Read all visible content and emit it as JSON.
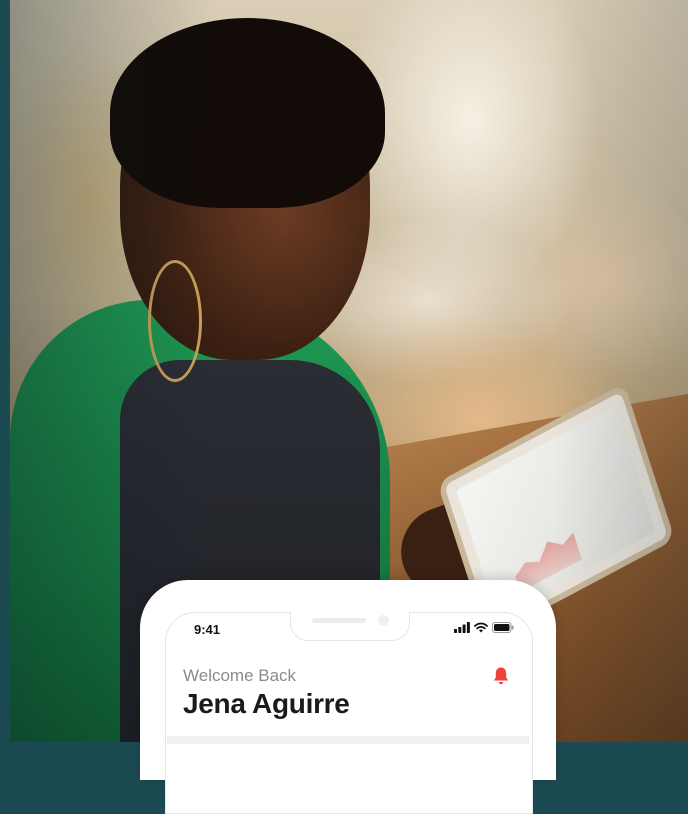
{
  "phone": {
    "status_time": "9:41",
    "welcome_text": "Welcome Back",
    "user_name": "Jena Aguirre"
  },
  "icons": {
    "notification": "bell-icon",
    "signal": "cellular-signal-icon",
    "wifi": "wifi-icon",
    "battery": "battery-icon"
  },
  "colors": {
    "accent": "#f0443a",
    "background": "#1c4a52",
    "text_primary": "#1a1a1a",
    "text_secondary": "#8b8b8f"
  }
}
